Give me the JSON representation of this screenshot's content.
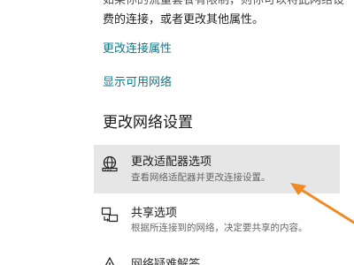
{
  "text": {
    "line1": "如果你的流量套餐有限制，则你可以将此网络设",
    "line2": "费的连接，或者更改其他属性。"
  },
  "links": {
    "change_properties": "更改连接属性",
    "show_networks": "显示可用网络"
  },
  "section": {
    "title": "更改网络设置"
  },
  "options": [
    {
      "title": "更改适配器选项",
      "subtitle": "查看网络适配器并更改连接设置。",
      "icon": "network-adapter-icon",
      "highlighted": true
    },
    {
      "title": "共享选项",
      "subtitle": "根据所连接到的网络，决定要共享的内容。",
      "icon": "sharing-icon",
      "highlighted": false
    },
    {
      "title": "网络疑难解答",
      "icon": "warning-icon",
      "highlighted": false
    }
  ],
  "annotation": {
    "arrow_color": "#f08a24"
  },
  "colors": {
    "link": "#0a7a8a",
    "highlight_bg": "#e6e6e6"
  }
}
